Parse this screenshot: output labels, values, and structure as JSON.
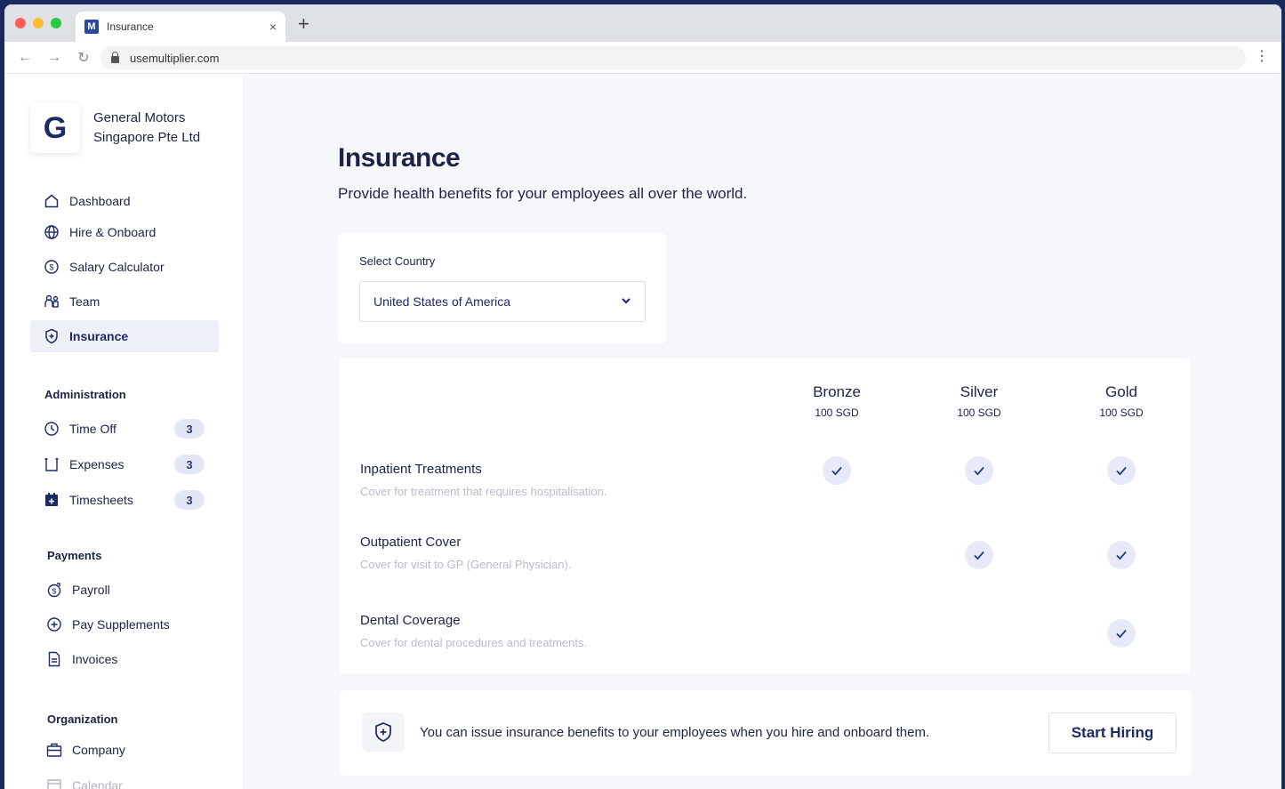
{
  "browser": {
    "tab_title": "Insurance",
    "tab_favicon": "M",
    "new_tab": "+",
    "close": "×",
    "url": "usemultiplier.com"
  },
  "company": {
    "logo_letter": "G",
    "name": "General Motors Singapore Pte Ltd"
  },
  "sidebar": {
    "main_items": [
      {
        "label": "Dashboard",
        "icon": "home-icon"
      },
      {
        "label": "Hire & Onboard",
        "icon": "globe-icon"
      },
      {
        "label": "Salary Calculator",
        "icon": "dollar-circle-icon"
      },
      {
        "label": "Team",
        "icon": "team-icon"
      },
      {
        "label": "Insurance",
        "icon": "shield-icon",
        "active": true
      }
    ],
    "administration": {
      "title": "Administration",
      "items": [
        {
          "label": "Time Off",
          "badge": "3",
          "icon": "clock-icon"
        },
        {
          "label": "Expenses",
          "badge": "3",
          "icon": "receipt-icon"
        },
        {
          "label": "Timesheets",
          "badge": "3",
          "icon": "calendar-plus-icon"
        }
      ]
    },
    "payments": {
      "title": "Payments",
      "items": [
        {
          "label": "Payroll",
          "icon": "payroll-icon"
        },
        {
          "label": "Pay Supplements",
          "icon": "plus-circle-icon"
        },
        {
          "label": "Invoices",
          "icon": "document-icon"
        }
      ]
    },
    "organization": {
      "title": "Organization",
      "items": [
        {
          "label": "Company",
          "icon": "briefcase-icon"
        },
        {
          "label": "Calendar",
          "icon": "calendar-icon"
        }
      ]
    }
  },
  "main": {
    "title": "Insurance",
    "subtitle": "Provide health benefits for your employees all over the world.",
    "country": {
      "label": "Select Country",
      "selected": "United States of America"
    },
    "tiers": [
      {
        "name": "Bronze",
        "price": "100 SGD"
      },
      {
        "name": "Silver",
        "price": "100 SGD"
      },
      {
        "name": "Gold",
        "price": "100 SGD"
      }
    ],
    "benefits": [
      {
        "name": "Inpatient Treatments",
        "desc": "Cover for treatment that requires hospitalisation.",
        "included": [
          true,
          true,
          true
        ]
      },
      {
        "name": "Outpatient Cover",
        "desc": "Cover for visit to GP (General Physician).",
        "included": [
          false,
          true,
          true
        ]
      },
      {
        "name": "Dental Coverage",
        "desc": "Cover for dental procedures and treatments.",
        "included": [
          false,
          false,
          true
        ]
      }
    ],
    "hire_banner": {
      "text": "You can issue insurance benefits to your employees when you hire and onboard them.",
      "button": "Start Hiring"
    }
  }
}
